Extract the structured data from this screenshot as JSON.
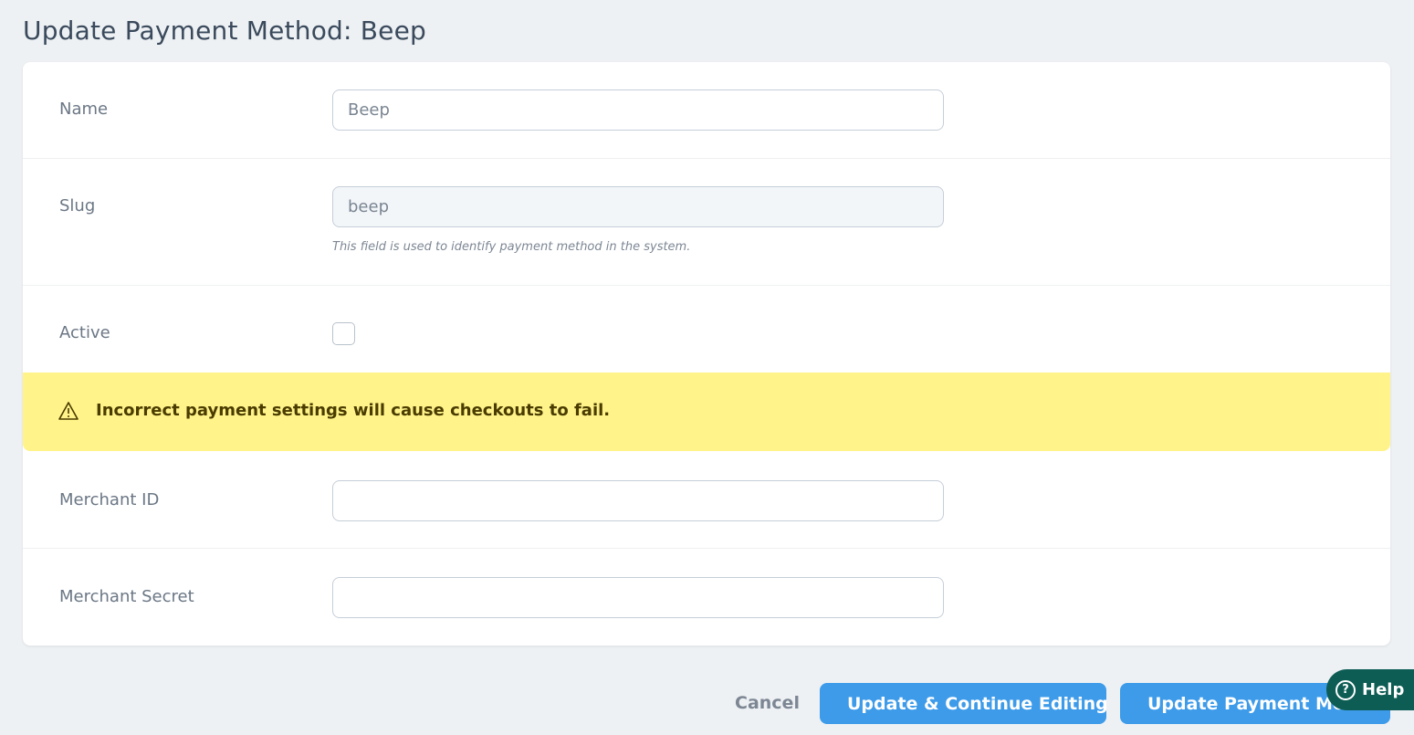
{
  "page": {
    "title": "Update Payment Method: Beep"
  },
  "form": {
    "name": {
      "label": "Name",
      "value": "Beep"
    },
    "slug": {
      "label": "Slug",
      "value": "beep",
      "hint": "This field is used to identify payment method in the system."
    },
    "active": {
      "label": "Active",
      "checked": false
    },
    "warning": {
      "icon": "warning-triangle-icon",
      "text": "Incorrect payment settings will cause checkouts to fail."
    },
    "merchant_id": {
      "label": "Merchant ID",
      "value": ""
    },
    "merchant_secret": {
      "label": "Merchant Secret",
      "value": ""
    }
  },
  "actions": {
    "cancel": "Cancel",
    "update_continue": "Update & Continue Editing",
    "update": "Update Payment Method"
  },
  "help": {
    "label": "Help",
    "icon": "question-circle-icon"
  },
  "colors": {
    "primary": "#3d9be9",
    "warning_bg": "#fff38a",
    "help_bg": "#0d5d55",
    "page_bg": "#eef1f4"
  }
}
